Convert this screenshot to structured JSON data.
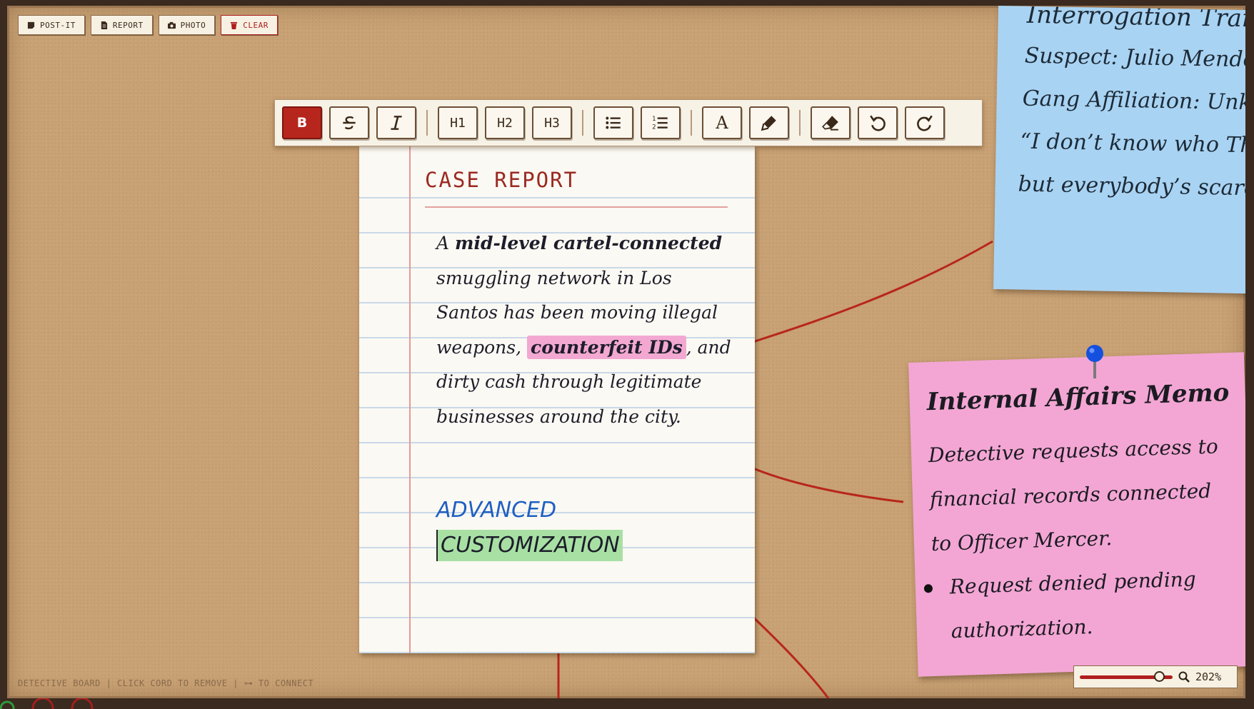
{
  "topbar": {
    "postit_label": "POST-IT",
    "report_label": "REPORT",
    "photo_label": "PHOTO",
    "clear_label": "CLEAR"
  },
  "toolbar": {
    "bold": "B",
    "h1": "H1",
    "h2": "H2",
    "h3": "H3",
    "text_color": "A"
  },
  "report": {
    "title": "CASE REPORT",
    "p_a": "A ",
    "p_bold": "mid-level cartel-connected",
    "p_mid": " smuggling network in Los Santos has been moving illegal weapons, ",
    "p_highlight": "counterfeit IDs",
    "p_end": ", and dirty cash through legitimate businesses around the city.",
    "advanced": "ADVANCED",
    "customization": "CUSTOMIZATION"
  },
  "note_blue": {
    "title": "Interrogation Transcript",
    "suspect": "Suspect: Julio Mendez",
    "affiliation": "Gang Affiliation: Unknown",
    "quote1": "“I don’t know who The Boss is,",
    "quote2": "but everybody’s scared of him.”"
  },
  "note_pink": {
    "title": "Internal Affairs Memo",
    "body": "Detective requests access to financial records connected to Officer Mercer.",
    "bullet": "Request denied pending authorization."
  },
  "footer": {
    "hint": "DETECTIVE BOARD | CLICK CORD TO REMOVE | ⊶ TO CONNECT"
  },
  "zoom": {
    "value_label": "202%",
    "slider_fraction": 0.85
  },
  "colors": {
    "cork": "#c8a174",
    "accent_red": "#b7261c",
    "note_blue": "#a9d3f3",
    "note_pink": "#f3a6d4",
    "highlight_pink": "#f3a8d2",
    "highlight_green": "#a8e0a4",
    "ink_blue": "#1f5fc2"
  },
  "icons": {
    "postit": "sticky-note-icon",
    "report": "document-icon",
    "photo": "camera-icon",
    "clear": "trash-icon",
    "pin": "push-pin-icon",
    "zoom": "magnifier-icon"
  }
}
